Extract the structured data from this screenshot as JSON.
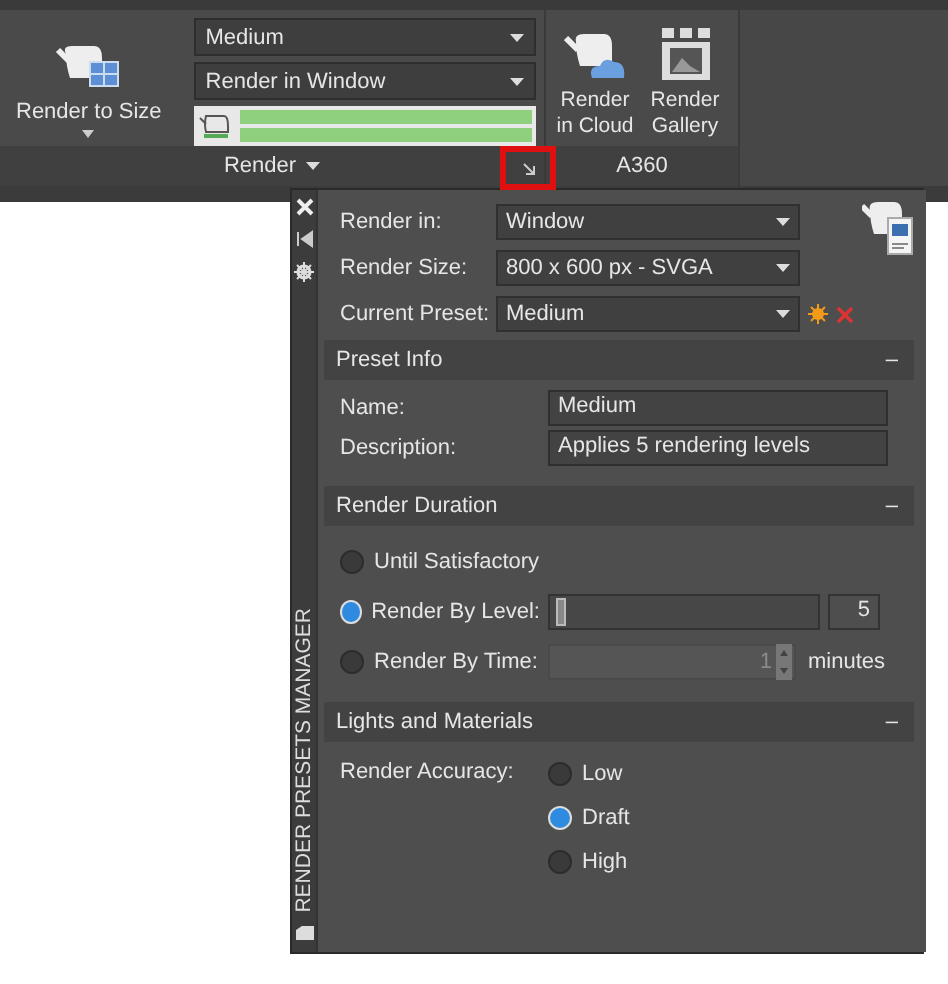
{
  "ribbon": {
    "render_panel": {
      "big_button": {
        "label": "Render to Size"
      },
      "dropdowns": [
        {
          "value": "Medium"
        },
        {
          "value": "Render in Window"
        }
      ],
      "progress_bars": [
        {
          "level": 1
        },
        {
          "level": 1
        }
      ],
      "footer": "Render",
      "launcher_highlighted": true
    },
    "a360_panel": {
      "buttons": [
        {
          "label": "Render in Cloud"
        },
        {
          "label": "Render Gallery"
        }
      ],
      "footer": "A360"
    }
  },
  "palette": {
    "title": "RENDER PRESETS MANAGER",
    "top_fields": [
      {
        "label": "Render in:",
        "value": "Window"
      },
      {
        "label": "Render Size:",
        "value": "800 x 600 px - SVGA"
      },
      {
        "label": "Current Preset:",
        "value": "Medium"
      }
    ],
    "sections": [
      {
        "kind": "info",
        "title": "Preset Info",
        "toggle": "–",
        "fields": [
          {
            "label": "Name:",
            "value": "Medium"
          },
          {
            "label": "Description:",
            "value": "Applies 5 rendering levels"
          }
        ]
      },
      {
        "kind": "duration",
        "title": "Render Duration",
        "toggle": "–",
        "options": [
          {
            "kind": "plain",
            "label": "Until Satisfactory",
            "selected": false
          },
          {
            "kind": "slider",
            "label": "Render By Level:",
            "selected": true,
            "level": 0.02,
            "value": "5"
          },
          {
            "kind": "spinner",
            "label": "Render By Time:",
            "selected": false,
            "value": "1",
            "unit": "minutes",
            "disabled": true
          }
        ]
      },
      {
        "kind": "accuracy",
        "title": "Lights and Materials",
        "toggle": "–",
        "label": "Render Accuracy:",
        "options": [
          {
            "label": "Low",
            "selected": false
          },
          {
            "label": "Draft",
            "selected": true
          },
          {
            "label": "High",
            "selected": false
          }
        ]
      }
    ]
  }
}
